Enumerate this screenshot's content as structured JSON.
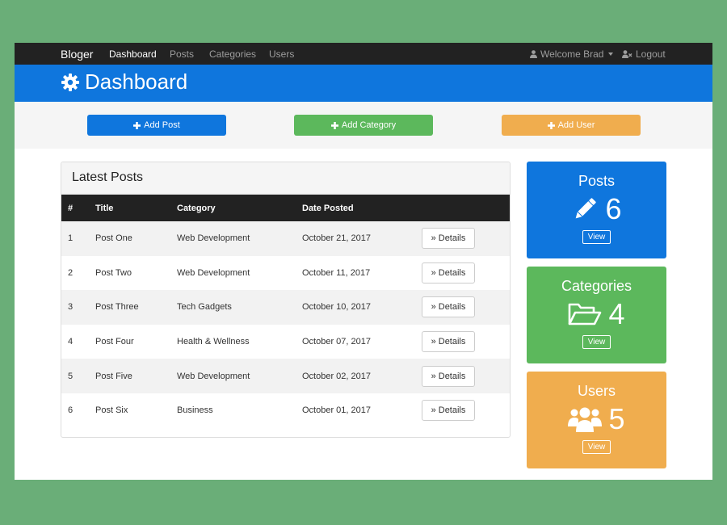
{
  "navbar": {
    "brand": "Bloger",
    "links": [
      "Dashboard",
      "Posts",
      "Categories",
      "Users"
    ],
    "welcome": "Welcome Brad",
    "logout": "Logout"
  },
  "header": {
    "title": "Dashboard"
  },
  "actions": {
    "add_post": "Add Post",
    "add_category": "Add Category",
    "add_user": "Add User"
  },
  "latest_posts": {
    "heading": "Latest Posts",
    "columns": [
      "#",
      "Title",
      "Category",
      "Date Posted"
    ],
    "details_label": "Details",
    "rows": [
      {
        "num": "1",
        "title": "Post One",
        "category": "Web Development",
        "date": "October 21, 2017"
      },
      {
        "num": "2",
        "title": "Post Two",
        "category": "Web Development",
        "date": "October 11, 2017"
      },
      {
        "num": "3",
        "title": "Post Three",
        "category": "Tech Gadgets",
        "date": "October 10, 2017"
      },
      {
        "num": "4",
        "title": "Post Four",
        "category": "Health & Wellness",
        "date": "October 07, 2017"
      },
      {
        "num": "5",
        "title": "Post Five",
        "category": "Web Development",
        "date": "October 02, 2017"
      },
      {
        "num": "6",
        "title": "Post Six",
        "category": "Business",
        "date": "October 01, 2017"
      }
    ]
  },
  "stats": {
    "posts": {
      "title": "Posts",
      "count": "6",
      "view": "View"
    },
    "categories": {
      "title": "Categories",
      "count": "4",
      "view": "View"
    },
    "users": {
      "title": "Users",
      "count": "5",
      "view": "View"
    }
  },
  "colors": {
    "primary": "#0f76dd",
    "success": "#5cb85c",
    "warning": "#f0ad4e",
    "navbar": "#222222",
    "backdrop": "#6aae78"
  }
}
